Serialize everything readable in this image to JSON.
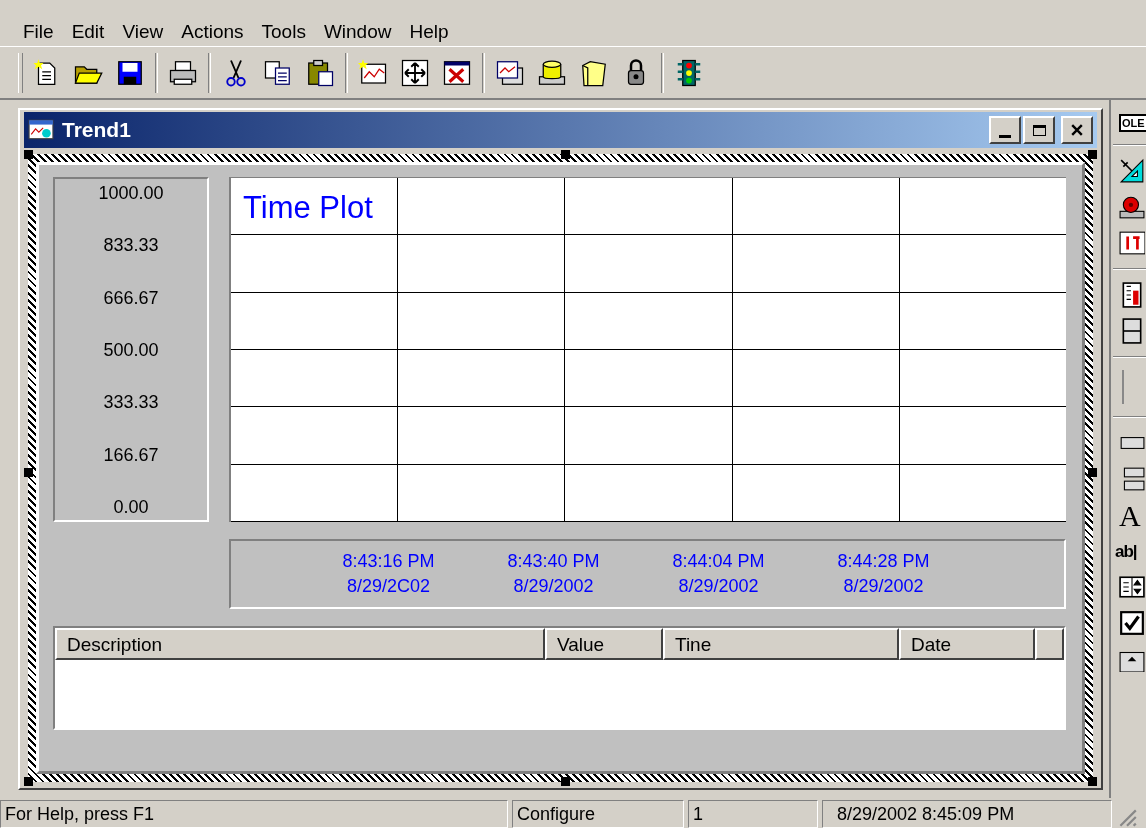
{
  "menu": [
    "File",
    "Edit",
    "View",
    "Actions",
    "Tools",
    "Window",
    "Help"
  ],
  "toolbar": [
    [
      {
        "kind": "new"
      },
      {
        "kind": "open"
      },
      {
        "kind": "save"
      }
    ],
    [
      {
        "kind": "print"
      }
    ],
    [
      {
        "kind": "cut"
      },
      {
        "kind": "copy"
      },
      {
        "kind": "paste"
      }
    ],
    [
      {
        "kind": "chart-new"
      },
      {
        "kind": "move"
      },
      {
        "kind": "delete"
      }
    ],
    [
      {
        "kind": "chart-window"
      },
      {
        "kind": "database"
      },
      {
        "kind": "folder"
      },
      {
        "kind": "lock"
      }
    ],
    [
      {
        "kind": "traffic"
      }
    ]
  ],
  "window": {
    "title": "Trend1"
  },
  "chart": {
    "title": "Time Plot",
    "y_labels": [
      "1000.00",
      "833.33",
      "666.67",
      "500.00",
      "333.33",
      "166.67",
      "0.00"
    ],
    "x_labels": [
      {
        "time": "8:43:16 PM",
        "date": "8/29/2C02"
      },
      {
        "time": "8:43:40 PM",
        "date": "8/29/2002"
      },
      {
        "time": "8:44:04 PM",
        "date": "8/29/2002"
      },
      {
        "time": "8:44:28 PM",
        "date": "8/29/2002"
      }
    ]
  },
  "table": {
    "columns": [
      "Description",
      "Value",
      "Tine",
      "Date"
    ]
  },
  "right_toolbar": [
    {
      "kind": "ole",
      "label": "OLE"
    },
    {
      "kind": "sep"
    },
    {
      "kind": "angle"
    },
    {
      "kind": "alarm"
    },
    {
      "kind": "counter"
    },
    {
      "kind": "sep"
    },
    {
      "kind": "gauge"
    },
    {
      "kind": "slider"
    },
    {
      "kind": "sep"
    },
    {
      "kind": "line"
    },
    {
      "kind": "sep"
    },
    {
      "kind": "pushbutton"
    },
    {
      "kind": "buttons"
    },
    {
      "kind": "text",
      "label": "A"
    },
    {
      "kind": "edit",
      "label": "ab|"
    },
    {
      "kind": "spin"
    },
    {
      "kind": "check"
    },
    {
      "kind": "scroll"
    }
  ],
  "status_bar": [
    "For Help, press F1",
    "Configure",
    "1",
    "8/29/2002 8:45:09 PM"
  ]
}
